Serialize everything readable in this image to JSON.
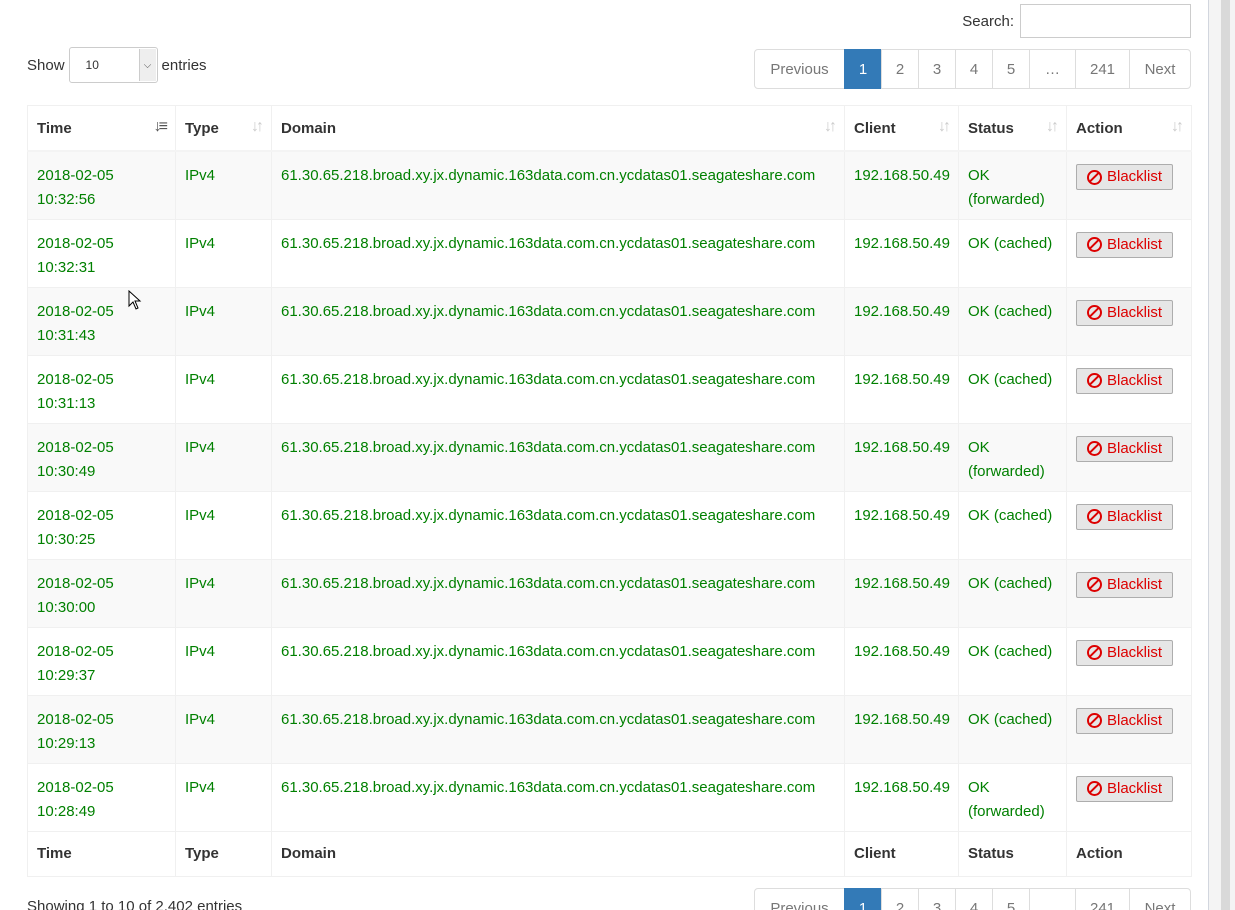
{
  "search": {
    "label": "Search:",
    "value": ""
  },
  "length": {
    "show_label": "Show",
    "selected": "10",
    "entries_label": "entries"
  },
  "pagination": {
    "previous": "Previous",
    "pages": [
      "1",
      "2",
      "3",
      "4",
      "5",
      "…",
      "241"
    ],
    "next": "Next",
    "active": "1"
  },
  "table": {
    "columns": [
      "Time",
      "Type",
      "Domain",
      "Client",
      "Status",
      "Action"
    ],
    "rows": [
      {
        "date": "2018-02-05",
        "time": "10:32:56",
        "type": "IPv4",
        "domain": "61.30.65.218.broad.xy.jx.dynamic.163data.com.cn.ycdatas01.seagateshare.com",
        "client": "192.168.50.49",
        "status": "OK (forwarded)",
        "action": "Blacklist"
      },
      {
        "date": "2018-02-05",
        "time": "10:32:31",
        "type": "IPv4",
        "domain": "61.30.65.218.broad.xy.jx.dynamic.163data.com.cn.ycdatas01.seagateshare.com",
        "client": "192.168.50.49",
        "status": "OK (cached)",
        "action": "Blacklist"
      },
      {
        "date": "2018-02-05",
        "time": "10:31:43",
        "type": "IPv4",
        "domain": "61.30.65.218.broad.xy.jx.dynamic.163data.com.cn.ycdatas01.seagateshare.com",
        "client": "192.168.50.49",
        "status": "OK (cached)",
        "action": "Blacklist"
      },
      {
        "date": "2018-02-05",
        "time": "10:31:13",
        "type": "IPv4",
        "domain": "61.30.65.218.broad.xy.jx.dynamic.163data.com.cn.ycdatas01.seagateshare.com",
        "client": "192.168.50.49",
        "status": "OK (cached)",
        "action": "Blacklist"
      },
      {
        "date": "2018-02-05",
        "time": "10:30:49",
        "type": "IPv4",
        "domain": "61.30.65.218.broad.xy.jx.dynamic.163data.com.cn.ycdatas01.seagateshare.com",
        "client": "192.168.50.49",
        "status": "OK (forwarded)",
        "action": "Blacklist"
      },
      {
        "date": "2018-02-05",
        "time": "10:30:25",
        "type": "IPv4",
        "domain": "61.30.65.218.broad.xy.jx.dynamic.163data.com.cn.ycdatas01.seagateshare.com",
        "client": "192.168.50.49",
        "status": "OK (cached)",
        "action": "Blacklist"
      },
      {
        "date": "2018-02-05",
        "time": "10:30:00",
        "type": "IPv4",
        "domain": "61.30.65.218.broad.xy.jx.dynamic.163data.com.cn.ycdatas01.seagateshare.com",
        "client": "192.168.50.49",
        "status": "OK (cached)",
        "action": "Blacklist"
      },
      {
        "date": "2018-02-05",
        "time": "10:29:37",
        "type": "IPv4",
        "domain": "61.30.65.218.broad.xy.jx.dynamic.163data.com.cn.ycdatas01.seagateshare.com",
        "client": "192.168.50.49",
        "status": "OK (cached)",
        "action": "Blacklist"
      },
      {
        "date": "2018-02-05",
        "time": "10:29:13",
        "type": "IPv4",
        "domain": "61.30.65.218.broad.xy.jx.dynamic.163data.com.cn.ycdatas01.seagateshare.com",
        "client": "192.168.50.49",
        "status": "OK (cached)",
        "action": "Blacklist"
      },
      {
        "date": "2018-02-05",
        "time": "10:28:49",
        "type": "IPv4",
        "domain": "61.30.65.218.broad.xy.jx.dynamic.163data.com.cn.ycdatas01.seagateshare.com",
        "client": "192.168.50.49",
        "status": "OK (forwarded)",
        "action": "Blacklist"
      }
    ]
  },
  "info": "Showing 1 to 10 of 2,402 entries",
  "colors": {
    "ok_text": "#008000",
    "blacklist_text": "#dd0000",
    "active_page": "#337ab7"
  },
  "icons": {
    "blacklist": "ban-icon",
    "sort_active": "sort-desc-icon",
    "sort": "sort-icon"
  }
}
